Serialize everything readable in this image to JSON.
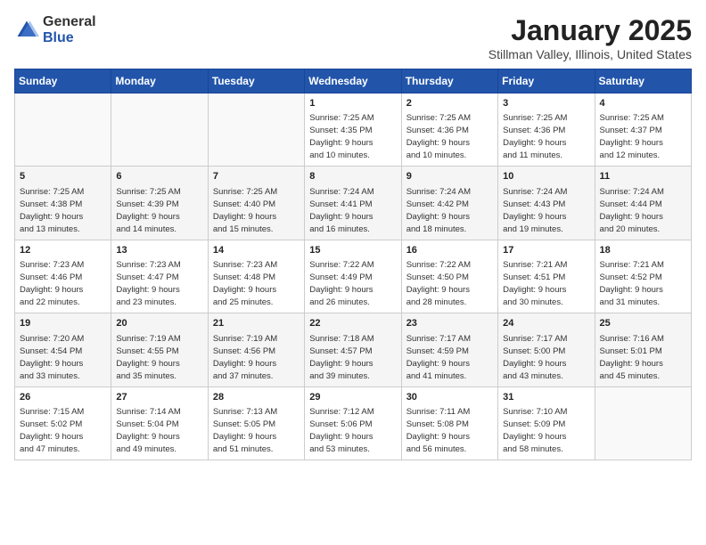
{
  "header": {
    "logo_general": "General",
    "logo_blue": "Blue",
    "month": "January 2025",
    "location": "Stillman Valley, Illinois, United States"
  },
  "days_of_week": [
    "Sunday",
    "Monday",
    "Tuesday",
    "Wednesday",
    "Thursday",
    "Friday",
    "Saturday"
  ],
  "weeks": [
    [
      {
        "day": "",
        "info": ""
      },
      {
        "day": "",
        "info": ""
      },
      {
        "day": "",
        "info": ""
      },
      {
        "day": "1",
        "info": "Sunrise: 7:25 AM\nSunset: 4:35 PM\nDaylight: 9 hours\nand 10 minutes."
      },
      {
        "day": "2",
        "info": "Sunrise: 7:25 AM\nSunset: 4:36 PM\nDaylight: 9 hours\nand 10 minutes."
      },
      {
        "day": "3",
        "info": "Sunrise: 7:25 AM\nSunset: 4:36 PM\nDaylight: 9 hours\nand 11 minutes."
      },
      {
        "day": "4",
        "info": "Sunrise: 7:25 AM\nSunset: 4:37 PM\nDaylight: 9 hours\nand 12 minutes."
      }
    ],
    [
      {
        "day": "5",
        "info": "Sunrise: 7:25 AM\nSunset: 4:38 PM\nDaylight: 9 hours\nand 13 minutes."
      },
      {
        "day": "6",
        "info": "Sunrise: 7:25 AM\nSunset: 4:39 PM\nDaylight: 9 hours\nand 14 minutes."
      },
      {
        "day": "7",
        "info": "Sunrise: 7:25 AM\nSunset: 4:40 PM\nDaylight: 9 hours\nand 15 minutes."
      },
      {
        "day": "8",
        "info": "Sunrise: 7:24 AM\nSunset: 4:41 PM\nDaylight: 9 hours\nand 16 minutes."
      },
      {
        "day": "9",
        "info": "Sunrise: 7:24 AM\nSunset: 4:42 PM\nDaylight: 9 hours\nand 18 minutes."
      },
      {
        "day": "10",
        "info": "Sunrise: 7:24 AM\nSunset: 4:43 PM\nDaylight: 9 hours\nand 19 minutes."
      },
      {
        "day": "11",
        "info": "Sunrise: 7:24 AM\nSunset: 4:44 PM\nDaylight: 9 hours\nand 20 minutes."
      }
    ],
    [
      {
        "day": "12",
        "info": "Sunrise: 7:23 AM\nSunset: 4:46 PM\nDaylight: 9 hours\nand 22 minutes."
      },
      {
        "day": "13",
        "info": "Sunrise: 7:23 AM\nSunset: 4:47 PM\nDaylight: 9 hours\nand 23 minutes."
      },
      {
        "day": "14",
        "info": "Sunrise: 7:23 AM\nSunset: 4:48 PM\nDaylight: 9 hours\nand 25 minutes."
      },
      {
        "day": "15",
        "info": "Sunrise: 7:22 AM\nSunset: 4:49 PM\nDaylight: 9 hours\nand 26 minutes."
      },
      {
        "day": "16",
        "info": "Sunrise: 7:22 AM\nSunset: 4:50 PM\nDaylight: 9 hours\nand 28 minutes."
      },
      {
        "day": "17",
        "info": "Sunrise: 7:21 AM\nSunset: 4:51 PM\nDaylight: 9 hours\nand 30 minutes."
      },
      {
        "day": "18",
        "info": "Sunrise: 7:21 AM\nSunset: 4:52 PM\nDaylight: 9 hours\nand 31 minutes."
      }
    ],
    [
      {
        "day": "19",
        "info": "Sunrise: 7:20 AM\nSunset: 4:54 PM\nDaylight: 9 hours\nand 33 minutes."
      },
      {
        "day": "20",
        "info": "Sunrise: 7:19 AM\nSunset: 4:55 PM\nDaylight: 9 hours\nand 35 minutes."
      },
      {
        "day": "21",
        "info": "Sunrise: 7:19 AM\nSunset: 4:56 PM\nDaylight: 9 hours\nand 37 minutes."
      },
      {
        "day": "22",
        "info": "Sunrise: 7:18 AM\nSunset: 4:57 PM\nDaylight: 9 hours\nand 39 minutes."
      },
      {
        "day": "23",
        "info": "Sunrise: 7:17 AM\nSunset: 4:59 PM\nDaylight: 9 hours\nand 41 minutes."
      },
      {
        "day": "24",
        "info": "Sunrise: 7:17 AM\nSunset: 5:00 PM\nDaylight: 9 hours\nand 43 minutes."
      },
      {
        "day": "25",
        "info": "Sunrise: 7:16 AM\nSunset: 5:01 PM\nDaylight: 9 hours\nand 45 minutes."
      }
    ],
    [
      {
        "day": "26",
        "info": "Sunrise: 7:15 AM\nSunset: 5:02 PM\nDaylight: 9 hours\nand 47 minutes."
      },
      {
        "day": "27",
        "info": "Sunrise: 7:14 AM\nSunset: 5:04 PM\nDaylight: 9 hours\nand 49 minutes."
      },
      {
        "day": "28",
        "info": "Sunrise: 7:13 AM\nSunset: 5:05 PM\nDaylight: 9 hours\nand 51 minutes."
      },
      {
        "day": "29",
        "info": "Sunrise: 7:12 AM\nSunset: 5:06 PM\nDaylight: 9 hours\nand 53 minutes."
      },
      {
        "day": "30",
        "info": "Sunrise: 7:11 AM\nSunset: 5:08 PM\nDaylight: 9 hours\nand 56 minutes."
      },
      {
        "day": "31",
        "info": "Sunrise: 7:10 AM\nSunset: 5:09 PM\nDaylight: 9 hours\nand 58 minutes."
      },
      {
        "day": "",
        "info": ""
      }
    ]
  ]
}
